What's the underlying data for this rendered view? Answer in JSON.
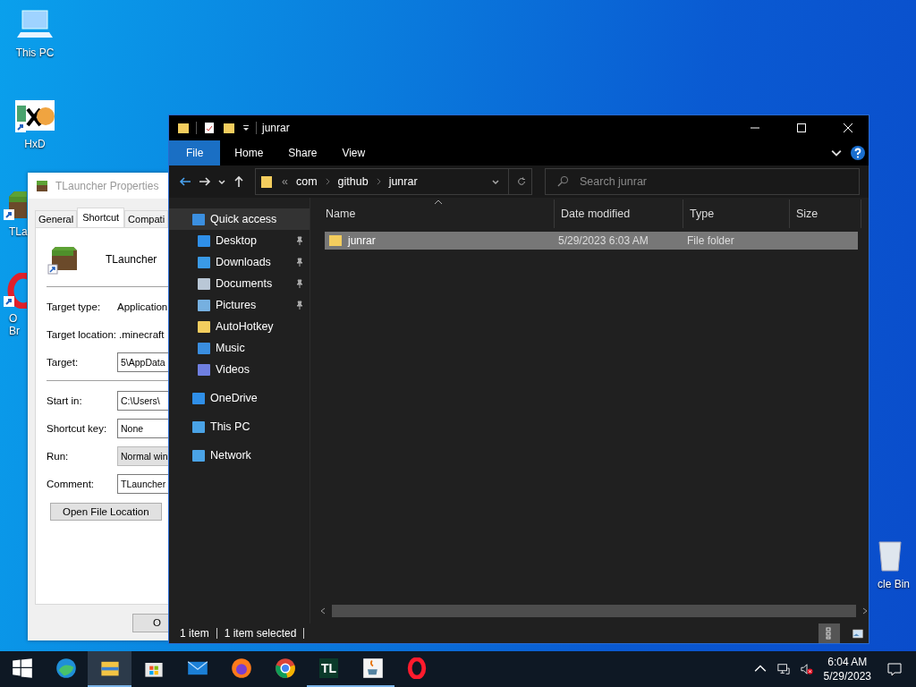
{
  "desktop_icons": [
    {
      "label": "This PC",
      "kind": "pc",
      "shortcut": false
    },
    {
      "label": "HxD",
      "kind": "hxd",
      "shortcut": true
    },
    {
      "label": "TLa",
      "kind": "grass",
      "shortcut": true
    },
    {
      "label": "O Br",
      "kind": "opera",
      "shortcut": true
    },
    {
      "label": "cle Bin",
      "kind": "bin",
      "shortcut": false
    }
  ],
  "properties_window": {
    "title": "TLauncher Properties",
    "name": "TLauncher",
    "tabs": [
      {
        "label": "General",
        "selected": false
      },
      {
        "label": "Shortcut",
        "selected": true
      },
      {
        "label": "Compati",
        "selected": false
      }
    ],
    "field_groups": [
      [
        {
          "label": "Target type:",
          "value": "Application",
          "kind": "text"
        },
        {
          "label": "Target location:",
          "value": ".minecraft",
          "kind": "text"
        },
        {
          "label": "Target:",
          "value": "5\\AppData",
          "kind": "input"
        }
      ],
      [
        {
          "label": "Start in:",
          "value": "C:\\Users\\",
          "kind": "input"
        },
        {
          "label": "Shortcut key:",
          "value": "None",
          "kind": "input"
        },
        {
          "label": "Run:",
          "value": "Normal win",
          "kind": "select"
        },
        {
          "label": "Comment:",
          "value": "TLauncher",
          "kind": "input"
        }
      ]
    ],
    "buttons": [
      "Open File Location"
    ],
    "footer_buttons": [
      "O"
    ]
  },
  "explorer": {
    "title": "junrar",
    "ribbon_tabs": [
      {
        "label": "File",
        "kind": "file"
      },
      {
        "label": "Home",
        "kind": "tab"
      },
      {
        "label": "Share",
        "kind": "tab"
      },
      {
        "label": "View",
        "kind": "tab"
      }
    ],
    "address": {
      "prefix": "«",
      "path": [
        "com",
        "github",
        "junrar"
      ]
    },
    "search": {
      "placeholder": "Search junrar"
    },
    "nav_pane": [
      {
        "label": "Quick access",
        "kind": "star",
        "selected": true,
        "children": [
          {
            "label": "Desktop",
            "kind": "desktop",
            "pinned": true,
            "selected": false
          },
          {
            "label": "Downloads",
            "kind": "download",
            "pinned": true,
            "selected": false
          },
          {
            "label": "Documents",
            "kind": "documents",
            "pinned": true,
            "selected": false
          },
          {
            "label": "Pictures",
            "kind": "pictures",
            "pinned": true,
            "selected": false
          },
          {
            "label": "AutoHotkey",
            "kind": "folder",
            "pinned": false,
            "selected": false
          },
          {
            "label": "Music",
            "kind": "music",
            "pinned": false,
            "selected": false
          },
          {
            "label": "Videos",
            "kind": "videos",
            "pinned": false,
            "selected": false
          }
        ]
      },
      {
        "label": "OneDrive",
        "kind": "cloud",
        "selected": false
      },
      {
        "label": "This PC",
        "kind": "pc",
        "selected": false
      },
      {
        "label": "Network",
        "kind": "network",
        "selected": false
      }
    ],
    "columns": [
      {
        "label": "Name",
        "sorted": true
      },
      {
        "label": "Date modified",
        "sorted": false
      },
      {
        "label": "Type",
        "sorted": false
      },
      {
        "label": "Size",
        "sorted": false
      }
    ],
    "rows": [
      {
        "name": "junrar",
        "date": "5/29/2023 6:03 AM",
        "type": "File folder",
        "selected": true
      }
    ],
    "status": {
      "count": "1 item",
      "selection": "1 item selected"
    },
    "view_buttons": [
      {
        "kind": "details",
        "selected": true
      },
      {
        "kind": "large",
        "selected": false
      }
    ]
  },
  "taskbar": {
    "items": [
      {
        "kind": "start",
        "running": false,
        "selected": false
      },
      {
        "kind": "edge",
        "running": false,
        "selected": false
      },
      {
        "kind": "explorer",
        "running": true,
        "selected": true
      },
      {
        "kind": "store",
        "running": false,
        "selected": false
      },
      {
        "kind": "mail",
        "running": false,
        "selected": false
      },
      {
        "kind": "firefox",
        "running": false,
        "selected": false
      },
      {
        "kind": "chrome",
        "running": false,
        "selected": false
      },
      {
        "kind": "tl",
        "label": "TL",
        "running": true,
        "selected": false
      },
      {
        "kind": "java",
        "running": true,
        "selected": false
      },
      {
        "kind": "opera",
        "running": false,
        "selected": false
      }
    ],
    "tray": {
      "time": "6:04 AM",
      "date": "5/29/2023",
      "muted": true
    }
  }
}
